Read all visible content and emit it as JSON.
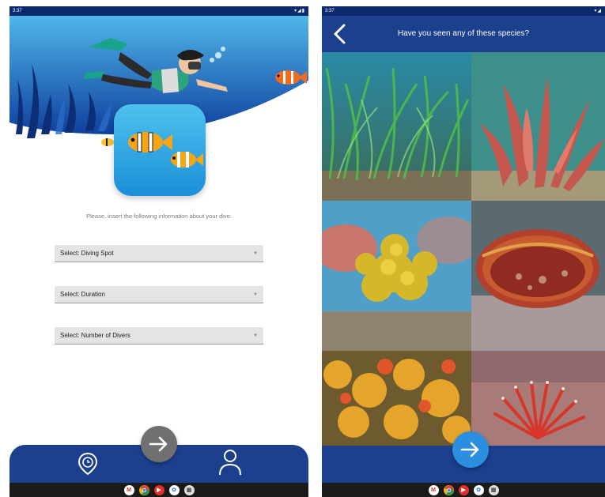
{
  "left_screen": {
    "status_bar": {
      "time": "3:37",
      "icons": "▾◢▮"
    },
    "prompt": "Please, insert the following information about your dive:",
    "selects": [
      {
        "label": "Select: Diving Spot"
      },
      {
        "label": "Select: Duration"
      },
      {
        "label": "Select: Number of Divers"
      }
    ],
    "nav": {
      "left_icon": "location-timer-icon",
      "fab_icon": "arrow-right-icon",
      "right_icon": "user-icon"
    }
  },
  "right_screen": {
    "status_bar": {
      "time": "3:37",
      "icons": "▾◢"
    },
    "title": "Have you seen any of these species?",
    "back_icon": "chevron-left-icon",
    "species_tiles": [
      {
        "subject": "seagrass meadow"
      },
      {
        "subject": "red feathery algae"
      },
      {
        "subject": "yellow sponge"
      },
      {
        "subject": "red fan shell"
      },
      {
        "subject": "orange encrusting coral"
      },
      {
        "subject": "red fan worm"
      }
    ],
    "fab_icon": "arrow-right-icon"
  },
  "system_nav_apps": [
    {
      "icon": "gmail-icon",
      "glyph": "M",
      "color": "#d93025"
    },
    {
      "icon": "chrome-icon",
      "glyph": "",
      "color": "#e8a23a"
    },
    {
      "icon": "youtube-icon",
      "glyph": "▶",
      "color": "#e52d27"
    },
    {
      "icon": "photos-icon",
      "glyph": "✿",
      "color": "#4285f4"
    },
    {
      "icon": "apps-icon",
      "glyph": "▦",
      "color": "#e0e0e0"
    }
  ],
  "colors": {
    "primary": "#1c3f8e",
    "status_bar": "#0b2a6e",
    "fab_grey": "#707070",
    "fab_blue": "#2b8ee0",
    "select_bg": "#e4e4e4"
  }
}
